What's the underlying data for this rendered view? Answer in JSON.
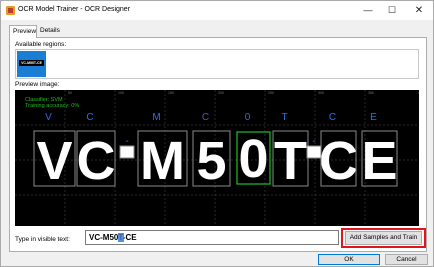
{
  "window": {
    "title": "OCR Model Trainer - OCR Designer",
    "controls": {
      "minimize": "—",
      "maximize": "☐",
      "close": "✕"
    }
  },
  "tabs": [
    {
      "label": "Preview",
      "active": true
    },
    {
      "label": "Details",
      "active": false
    }
  ],
  "regions": {
    "label": "Available regions:",
    "thumbnail_text": "VC-M50T-CE"
  },
  "preview": {
    "label": "Preview image:",
    "info_lines": [
      "Classifier: SVM",
      "Training accuracy: 0%"
    ],
    "grid_labels": [
      "50",
      "100",
      "150",
      "200",
      "250",
      "300",
      "350",
      "400"
    ],
    "characters": [
      {
        "glyph": "V",
        "predicted": "V",
        "box_color": "#8a8a8a",
        "label_color": "#2b6fe6"
      },
      {
        "glyph": "C",
        "predicted": "C",
        "box_color": "#8a8a8a",
        "label_color": "#2b6fe6"
      },
      {
        "glyph": "-",
        "predicted": "-",
        "box_color": "#8a8a8a",
        "label_color": "#2b6fe6"
      },
      {
        "glyph": "M",
        "predicted": "M",
        "box_color": "#8a8a8a",
        "label_color": "#2b6fe6"
      },
      {
        "glyph": "5",
        "predicted": "C",
        "box_color": "#8a8a8a",
        "label_color": "#7a3fc8"
      },
      {
        "glyph": "0",
        "predicted": "0",
        "box_color": "#1fbf2a",
        "label_color": "#2b6fe6"
      },
      {
        "glyph": "T",
        "predicted": "T",
        "box_color": "#8a8a8a",
        "label_color": "#2b6fe6"
      },
      {
        "glyph": "-",
        "predicted": "-",
        "box_color": "#8a8a8a",
        "label_color": "#2b6fe6"
      },
      {
        "glyph": "C",
        "predicted": "C",
        "box_color": "#8a8a8a",
        "label_color": "#2b6fe6"
      },
      {
        "glyph": "E",
        "predicted": "E",
        "box_color": "#8a8a8a",
        "label_color": "#2b6fe6"
      }
    ],
    "info_color": "#20c020"
  },
  "input": {
    "label": "Type in visible text:",
    "value": "VC-M50T-CE"
  },
  "buttons": {
    "train": "Add Samples and Train",
    "ok": "OK",
    "cancel": "Cancel"
  },
  "colors": {
    "highlight": "#e0161b",
    "accent": "#0078d7"
  }
}
